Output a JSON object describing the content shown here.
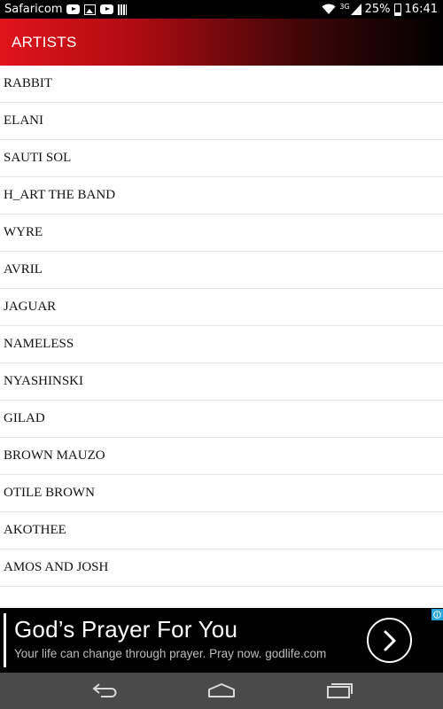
{
  "status_bar": {
    "carrier": "Safaricom",
    "left_icons": [
      "youtube-icon",
      "image-icon",
      "youtube-icon",
      "signal-bars-icon"
    ],
    "network_type": "3G",
    "battery": "25%",
    "time": "16:41"
  },
  "app_bar": {
    "title": "ARTISTS",
    "gradient_colors": [
      "#e0141b",
      "#000000"
    ]
  },
  "artists": [
    "RABBIT",
    "ELANI",
    "SAUTI SOL",
    "H_ART THE BAND",
    "WYRE",
    "AVRIL",
    "JAGUAR",
    "NAMELESS",
    "NYASHINSKI",
    "GILAD",
    "BROWN MAUZO",
    "OTILE BROWN",
    "AKOTHEE",
    "AMOS AND JOSH"
  ],
  "ad": {
    "headline": "God’s Prayer For You",
    "subtext": "Your life can change through prayer. Pray now.",
    "url": "godlife.com",
    "info_color": "#2aa7d9"
  },
  "nav_bar": {
    "buttons": [
      "back-icon",
      "home-icon",
      "recent-apps-icon"
    ]
  }
}
